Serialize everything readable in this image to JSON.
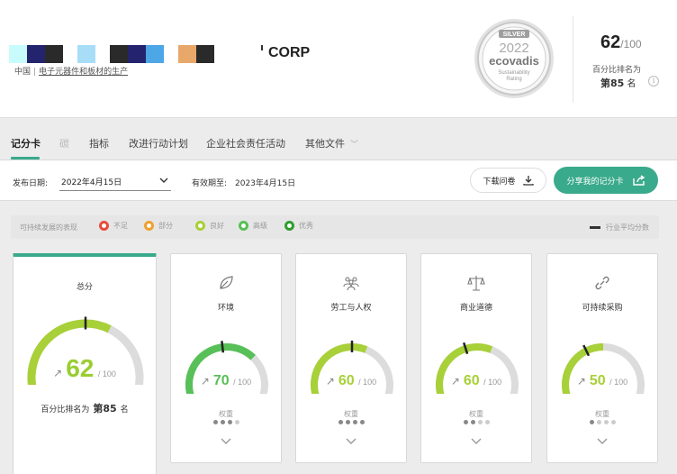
{
  "header": {
    "company_suffix": "CORP",
    "country": "中国",
    "separator": "|",
    "industry": "电子元器件和板材的生产",
    "medal": {
      "tier": "SILVER",
      "year": "2022",
      "brand": "ecovadis",
      "sub1": "Sustainability",
      "sub2": "Rating"
    },
    "score": "62",
    "score_max": "/100",
    "percentile_label": "百分比排名为",
    "rank_prefix": "第85",
    "rank_suffix": "名",
    "info_glyph": "i"
  },
  "tabs": [
    {
      "label": "记分卡",
      "state": "active"
    },
    {
      "label": "碳",
      "state": "disabled"
    },
    {
      "label": "指标",
      "state": "normal"
    },
    {
      "label": "改进行动计划",
      "state": "normal"
    },
    {
      "label": "企业社会责任活动",
      "state": "normal"
    },
    {
      "label": "其他文件",
      "state": "normal"
    }
  ],
  "datebar": {
    "publish_label": "发布日期:",
    "publish_value": "2022年4月15日",
    "valid_label": "有效期至:",
    "valid_value": "2023年4月15日",
    "download_label": "下载问卷",
    "share_label": "分享我的记分卡"
  },
  "legend": {
    "title": "可持续发展的表现",
    "items": [
      {
        "label": "不足",
        "color": "#e74c3c"
      },
      {
        "label": "部分",
        "color": "#f0a030"
      },
      {
        "label": "良好",
        "color": "#a8d038"
      },
      {
        "label": "高级",
        "color": "#58c058"
      },
      {
        "label": "优秀",
        "color": "#2e9e2e"
      }
    ],
    "avg_label": "行业平均分数"
  },
  "total": {
    "title": "总分",
    "score": "62",
    "max": "/ 100",
    "trend": "↗",
    "rank_label": "百分比排名为",
    "rank_value": "第85",
    "rank_suffix": "名",
    "value": 62,
    "avg": 50,
    "color": "#a8d038"
  },
  "themes": [
    {
      "title": "环境",
      "icon": "leaf-icon",
      "score": "70",
      "max": "/ 100",
      "trend": "↗",
      "value": 70,
      "avg": 47,
      "color": "#58c058",
      "weight_label": "权重",
      "weight": 3
    },
    {
      "title": "劳工与人权",
      "icon": "people-icon",
      "score": "60",
      "max": "/ 100",
      "trend": "↗",
      "value": 60,
      "avg": 50,
      "color": "#a8d038",
      "weight_label": "权重",
      "weight": 4
    },
    {
      "title": "商业道德",
      "icon": "scales-icon",
      "score": "60",
      "max": "/ 100",
      "trend": "↗",
      "value": 60,
      "avg": 42,
      "color": "#a8d038",
      "weight_label": "权重",
      "weight": 2
    },
    {
      "title": "可持续采购",
      "icon": "link-icon",
      "score": "50",
      "max": "/ 100",
      "trend": "↗",
      "value": 50,
      "avg": 38,
      "color": "#a8d038",
      "weight_label": "权重",
      "weight": 1
    }
  ]
}
